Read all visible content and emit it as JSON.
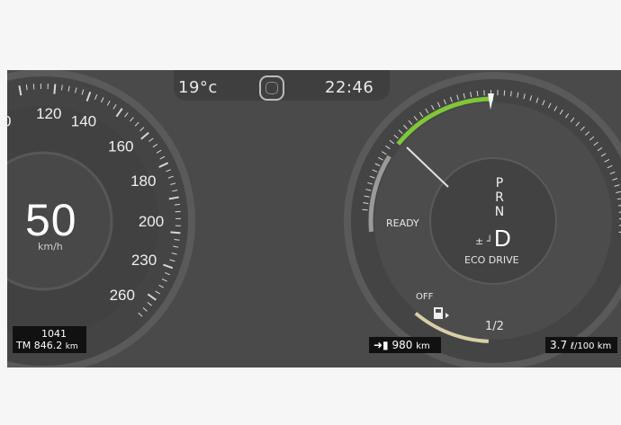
{
  "header": {
    "temperature": "19°c",
    "time": "22:46",
    "center_icon": "car-status-icon"
  },
  "speedometer": {
    "speed": "50",
    "unit": "km/h",
    "scale_labels": [
      "00",
      "120",
      "140",
      "160",
      "180",
      "200",
      "230",
      "260"
    ]
  },
  "odometer": {
    "trip_value": "1041",
    "label": "TM",
    "total": "846.2",
    "unit": "km"
  },
  "hybrid_gauge": {
    "ready_label": "READY",
    "off_label": "OFF",
    "mode_label": "ECO DRIVE",
    "power_level": 0.52
  },
  "gear": {
    "options": [
      "P",
      "R",
      "N"
    ],
    "selected": "D",
    "manual_indicator": "± ┘"
  },
  "fuel": {
    "half_label": "1/2",
    "icon": "fuel-pump-icon",
    "level": 0.35
  },
  "range": {
    "icon": "arrow-fuel-icon",
    "value": "980",
    "unit": "km"
  },
  "consumption": {
    "value": "3.7",
    "unit": "ℓ/100 km"
  },
  "colors": {
    "background": "#4a4a4a",
    "power_green": "#7fc63a",
    "fuel_beige": "#d8cfa8"
  }
}
